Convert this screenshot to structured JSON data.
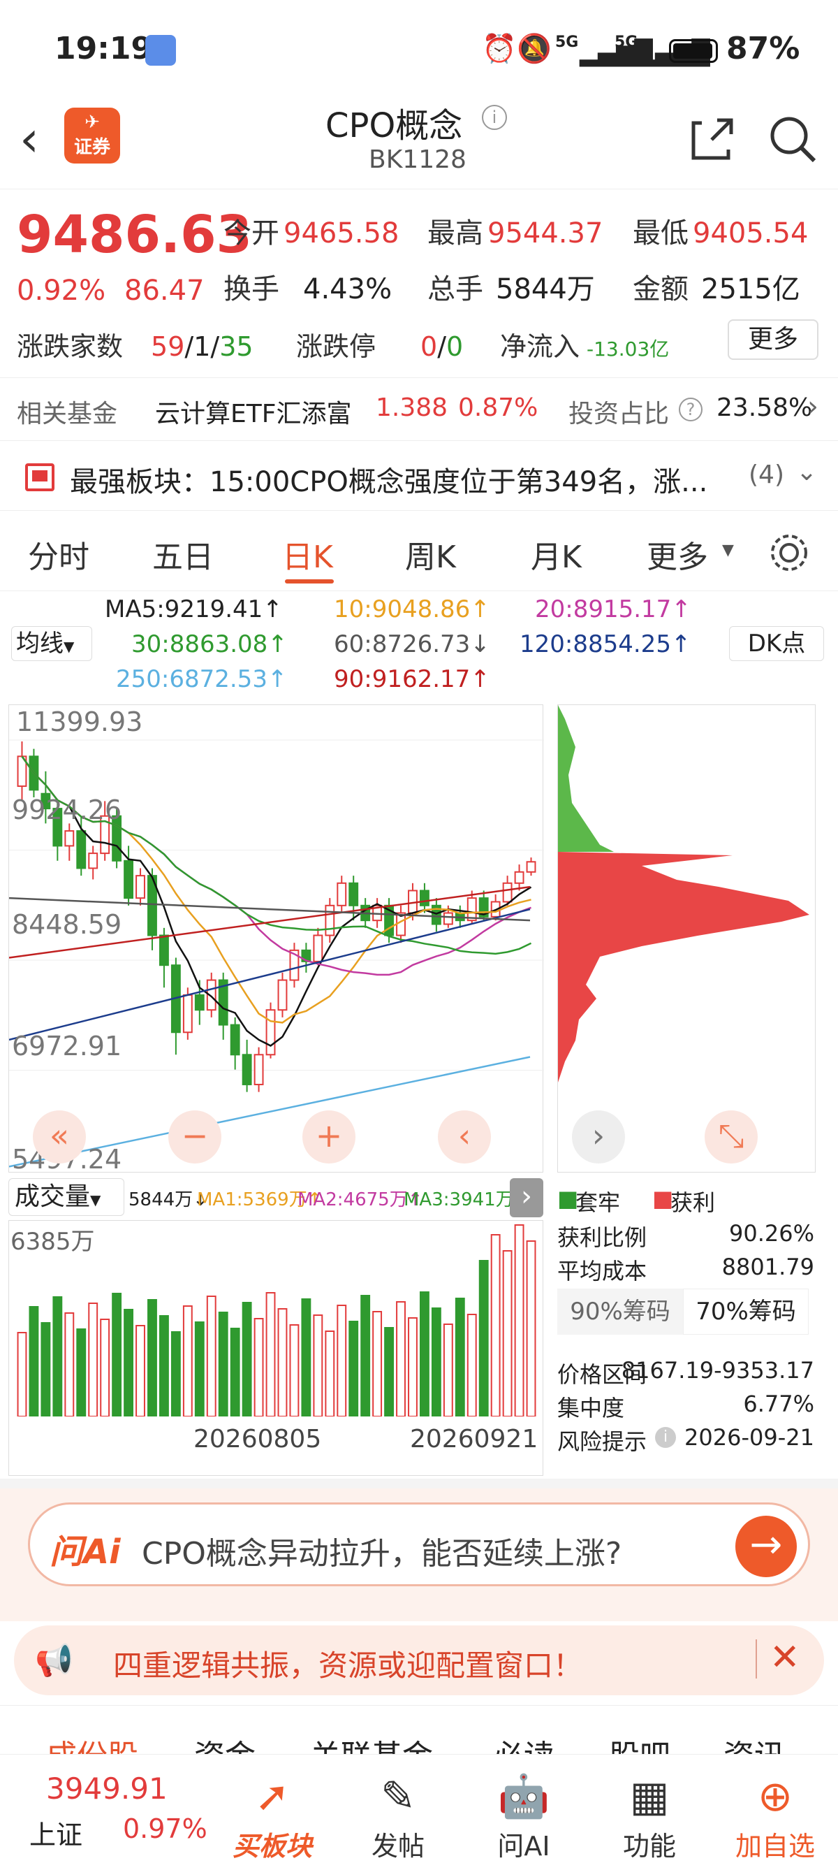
{
  "status": {
    "time": "19:19",
    "battery": "87%",
    "signal1": "5G",
    "signal2": "5G"
  },
  "nav": {
    "title": "CPO概念",
    "code": "BK1128",
    "logo_text": "证券"
  },
  "quote": {
    "price": "9486.63",
    "change_pct": "0.92%",
    "change": "86.47",
    "open_label": "今开",
    "open": "9465.58",
    "high_label": "最高",
    "high": "9544.37",
    "low_label": "最低",
    "low": "9405.54",
    "turnover_label": "换手",
    "turnover": "4.43%",
    "volume_label": "总手",
    "volume": "5844万",
    "amount_label": "金额",
    "amount": "2515亿",
    "updown_label": "涨跌家数",
    "up": "59",
    "flat": "1",
    "down": "35",
    "slash": "/",
    "limit_label": "涨跌停",
    "limit_up": "0",
    "limit_down": "0",
    "inflow_label": "净流入",
    "inflow": "-13.03亿",
    "more_btn": "更多"
  },
  "fund": {
    "label": "相关基金",
    "name": "云计算ETF汇添富",
    "price": "1.388",
    "pct": "0.87%",
    "ratio_label": "投资占比",
    "ratio": "23.58%"
  },
  "notice": {
    "text": "最强板块：15:00CPO概念强度位于第349名，涨...",
    "count": "(4)"
  },
  "tabs": [
    "分时",
    "五日",
    "日K",
    "周K",
    "月K",
    "更多"
  ],
  "ma": {
    "selector": "均线",
    "ma5": "MA5:9219.41↑",
    "ma10": "10:9048.86↑",
    "ma20": "20:8915.17↑",
    "ma30": "30:8863.08↑",
    "ma60": "60:8726.73↓",
    "ma120": "120:8854.25↑",
    "ma250": "250:6872.53↑",
    "ma90": "90:9162.17↑",
    "dk": "DK点"
  },
  "chart_data": {
    "type": "candlestick",
    "yticks": [
      "11399.93",
      "9924.26",
      "8448.59",
      "6972.91",
      "5497.24"
    ],
    "ylim": [
      5497.24,
      11399.93
    ],
    "candles": [
      [
        10500,
        10900,
        10300,
        11100
      ],
      [
        10900,
        10450,
        10350,
        11000
      ],
      [
        10400,
        10200,
        10000,
        10700
      ],
      [
        10200,
        9700,
        9500,
        10300
      ],
      [
        9700,
        9900,
        9500,
        10000
      ],
      [
        9900,
        9400,
        9300,
        10100
      ],
      [
        9400,
        9600,
        9250,
        9700
      ],
      [
        9600,
        10100,
        9500,
        10300
      ],
      [
        10100,
        9500,
        9400,
        10200
      ],
      [
        9500,
        9000,
        8900,
        9700
      ],
      [
        9000,
        9300,
        8900,
        9400
      ],
      [
        9300,
        8500,
        8300,
        9400
      ],
      [
        8500,
        8100,
        7800,
        8600
      ],
      [
        8100,
        7200,
        6900,
        8200
      ],
      [
        7200,
        7700,
        7100,
        7800
      ],
      [
        7700,
        7500,
        7300,
        7900
      ],
      [
        7500,
        7900,
        7400,
        8000
      ],
      [
        7900,
        7300,
        7100,
        8000
      ],
      [
        7300,
        6900,
        6700,
        7400
      ],
      [
        6900,
        6500,
        6400,
        7100
      ],
      [
        6500,
        6900,
        6400,
        7000
      ],
      [
        6900,
        7500,
        6850,
        7600
      ],
      [
        7500,
        7900,
        7400,
        8000
      ],
      [
        7900,
        8300,
        7800,
        8400
      ],
      [
        8300,
        8150,
        8000,
        8400
      ],
      [
        8150,
        8500,
        8100,
        8600
      ],
      [
        8500,
        8900,
        8400,
        9000
      ],
      [
        8900,
        9200,
        8800,
        9300
      ],
      [
        9200,
        8900,
        8700,
        9300
      ],
      [
        8900,
        8700,
        8600,
        9000
      ],
      [
        8700,
        8900,
        8600,
        9000
      ],
      [
        8900,
        8500,
        8400,
        9000
      ],
      [
        8500,
        8800,
        8400,
        8900
      ],
      [
        8800,
        9100,
        8700,
        9200
      ],
      [
        9100,
        8900,
        8800,
        9200
      ],
      [
        8900,
        8650,
        8550,
        9000
      ],
      [
        8650,
        8800,
        8600,
        8900
      ],
      [
        8800,
        8700,
        8600,
        8900
      ],
      [
        8700,
        9000,
        8650,
        9100
      ],
      [
        9000,
        8750,
        8700,
        9100
      ],
      [
        8750,
        8950,
        8700,
        9050
      ],
      [
        8950,
        9200,
        8900,
        9300
      ],
      [
        9200,
        9350,
        9100,
        9450
      ],
      [
        9350,
        9486,
        9300,
        9544
      ]
    ],
    "volume_label": "成交量",
    "vol_max": "6385万",
    "vol": "5844万↓",
    "ma1": "MA1:5369万↑",
    "ma2": "MA2:4675万↑",
    "ma3": "MA3:3941万↑",
    "dates": [
      "20260805",
      "20260921"
    ]
  },
  "chip": {
    "legend_trap": "套牢",
    "legend_profit": "获利",
    "profit_ratio_label": "获利比例",
    "profit_ratio": "90.26%",
    "avg_cost_label": "平均成本",
    "avg_cost": "8801.79",
    "tab90": "90%筹码",
    "tab70": "70%筹码",
    "range_label": "价格区间",
    "range": "8167.19-9353.17",
    "concentration_label": "集中度",
    "concentration": "6.77%",
    "risk_label": "风险提示",
    "risk_date": "2026-09-21"
  },
  "ai": {
    "logo": "问Ai",
    "question": "CPO概念异动拉升，能否延续上涨?"
  },
  "banner": {
    "text": "四重逻辑共振，资源或迎配置窗口！"
  },
  "subtabs": [
    "成份股",
    "资金",
    "关联基金",
    "必读",
    "股吧",
    "资讯"
  ],
  "bottom": {
    "index_value": "3949.91",
    "index_name": "上证",
    "index_pct": "0.97%",
    "buy": "买板块",
    "post": "发帖",
    "ai": "问AI",
    "func": "功能",
    "add": "加自选"
  },
  "colors": {
    "up": "#e23b3b",
    "down": "#2f9a2f",
    "accent": "#e5532c"
  }
}
